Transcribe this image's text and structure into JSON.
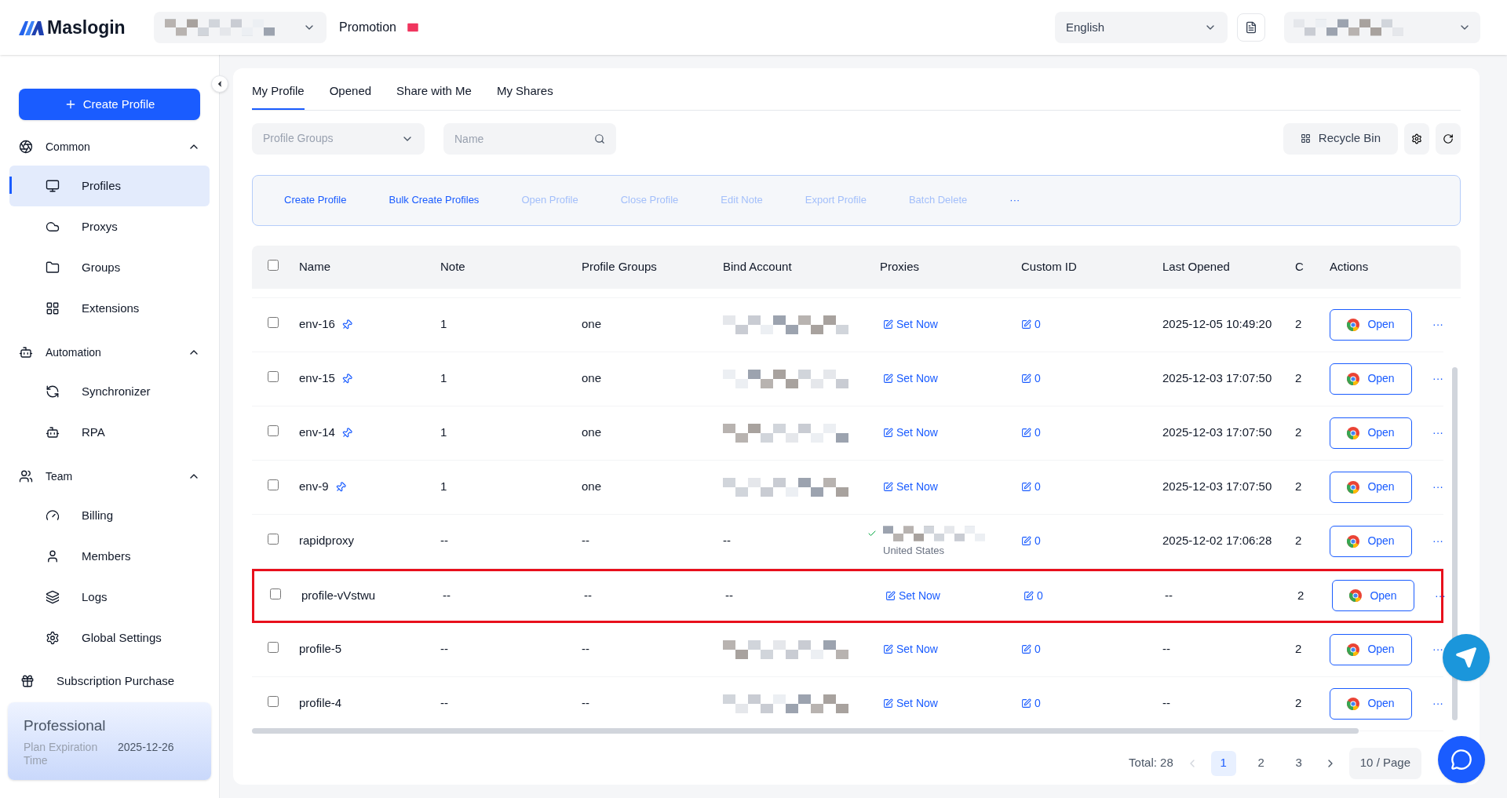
{
  "brand": {
    "name": "Maslogin"
  },
  "header": {
    "promotion": "Promotion",
    "language": "English"
  },
  "sidebar": {
    "create_button": "Create Profile",
    "sections": [
      {
        "kind": "group",
        "label": "Common",
        "expanded": true,
        "children": [
          {
            "label": "Profiles",
            "selected": true
          },
          {
            "label": "Proxys",
            "selected": false
          },
          {
            "label": "Groups",
            "selected": false
          },
          {
            "label": "Extensions",
            "selected": false
          }
        ]
      },
      {
        "kind": "group",
        "label": "Automation",
        "expanded": true,
        "children": [
          {
            "label": "Synchronizer",
            "selected": false
          },
          {
            "label": "RPA",
            "selected": false
          }
        ]
      },
      {
        "kind": "group",
        "label": "Team",
        "expanded": true,
        "children": [
          {
            "label": "Billing",
            "selected": false
          },
          {
            "label": "Members",
            "selected": false
          },
          {
            "label": "Logs",
            "selected": false
          },
          {
            "label": "Global Settings",
            "selected": false
          }
        ]
      },
      {
        "kind": "link",
        "label": "Subscription Purchase"
      }
    ],
    "plan": {
      "name": "Professional",
      "label": "Plan Expiration Time",
      "value": "2025-12-26"
    }
  },
  "tabs": [
    {
      "label": "My Profile",
      "selected": true
    },
    {
      "label": "Opened",
      "selected": false
    },
    {
      "label": "Share with Me",
      "selected": false
    },
    {
      "label": "My Shares",
      "selected": false
    }
  ],
  "filters": {
    "groups_placeholder": "Profile Groups",
    "name_placeholder": "Name",
    "recycle_bin": "Recycle Bin"
  },
  "toolbar": [
    {
      "label": "Create Profile",
      "disabled": false
    },
    {
      "label": "Bulk Create Profiles",
      "disabled": false
    },
    {
      "label": "Open Profile",
      "disabled": true
    },
    {
      "label": "Close Profile",
      "disabled": true
    },
    {
      "label": "Edit Note",
      "disabled": true
    },
    {
      "label": "Export Profile",
      "disabled": true
    },
    {
      "label": "Batch Delete",
      "disabled": true
    },
    {
      "label": "···",
      "disabled": false
    }
  ],
  "table": {
    "select_all_checked": false,
    "columns": [
      "Name",
      "Note",
      "Profile Groups",
      "Bind Account",
      "Proxies",
      "Custom ID",
      "Last Opened",
      "C",
      "Actions"
    ],
    "rows": [
      {
        "name": "env-16",
        "pinned": true,
        "note": "1",
        "group": "one",
        "bind_redacted": true,
        "proxy": {
          "kind": "unset",
          "label": "Set Now"
        },
        "custom_id": "0",
        "last_opened": "2025-12-05 10:49:20",
        "column_9": "2",
        "action": "Open",
        "more": "···",
        "highlighted": false,
        "checked": false
      },
      {
        "name": "env-15",
        "pinned": true,
        "note": "1",
        "group": "one",
        "bind_redacted": true,
        "proxy": {
          "kind": "unset",
          "label": "Set Now"
        },
        "custom_id": "0",
        "last_opened": "2025-12-03 17:07:50",
        "column_9": "2",
        "action": "Open",
        "more": "···",
        "highlighted": false,
        "checked": false
      },
      {
        "name": "env-14",
        "pinned": true,
        "note": "1",
        "group": "one",
        "bind_redacted": true,
        "proxy": {
          "kind": "unset",
          "label": "Set Now"
        },
        "custom_id": "0",
        "last_opened": "2025-12-03 17:07:50",
        "column_9": "2",
        "action": "Open",
        "more": "···",
        "highlighted": false,
        "checked": false
      },
      {
        "name": "env-9",
        "pinned": true,
        "note": "1",
        "group": "one",
        "bind_redacted": true,
        "proxy": {
          "kind": "unset",
          "label": "Set Now"
        },
        "custom_id": "0",
        "last_opened": "2025-12-03 17:07:50",
        "column_9": "2",
        "action": "Open",
        "more": "···",
        "highlighted": false,
        "checked": false
      },
      {
        "name": "rapidproxy",
        "pinned": false,
        "note": "--",
        "group": "--",
        "bind": "--",
        "bind_redacted": false,
        "proxy": {
          "kind": "assigned",
          "country": "United States"
        },
        "custom_id": "0",
        "last_opened": "2025-12-02 17:06:28",
        "column_9": "2",
        "action": "Open",
        "more": "···",
        "highlighted": false,
        "checked": false
      },
      {
        "name": "profile-vVstwu",
        "pinned": false,
        "note": "--",
        "group": "--",
        "bind": "--",
        "bind_redacted": false,
        "proxy": {
          "kind": "unset",
          "label": "Set Now"
        },
        "custom_id": "0",
        "last_opened": "--",
        "column_9": "2",
        "action": "Open",
        "more": "···",
        "highlighted": true,
        "checked": false
      },
      {
        "name": "profile-5",
        "pinned": false,
        "note": "--",
        "group": "--",
        "bind_redacted": true,
        "proxy": {
          "kind": "unset",
          "label": "Set Now"
        },
        "custom_id": "0",
        "last_opened": "--",
        "column_9": "2",
        "action": "Open",
        "more": "···",
        "highlighted": false,
        "checked": false
      },
      {
        "name": "profile-4",
        "pinned": false,
        "note": "--",
        "group": "--",
        "bind_redacted": true,
        "proxy": {
          "kind": "unset",
          "label": "Set Now"
        },
        "custom_id": "0",
        "last_opened": "--",
        "column_9": "2",
        "action": "Open",
        "more": "···",
        "highlighted": false,
        "checked": false
      }
    ]
  },
  "pagination": {
    "total": "Total: 28",
    "pages": [
      {
        "label": "1",
        "selected": true
      },
      {
        "label": "2",
        "selected": false
      },
      {
        "label": "3",
        "selected": false
      }
    ],
    "page_size": "10 / Page"
  }
}
